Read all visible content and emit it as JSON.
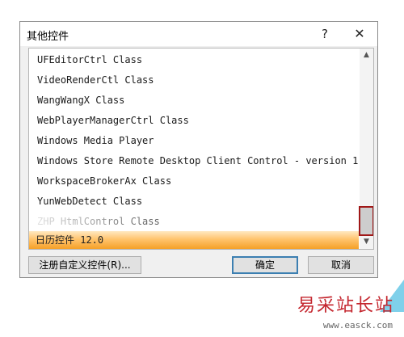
{
  "dialog": {
    "title": "其他控件",
    "help_glyph": "?",
    "close_glyph": "✕"
  },
  "list": {
    "items": [
      "UFEditorCtrl Class",
      "VideoRenderCtl Class",
      "WangWangX Class",
      "WebPlayerManagerCtrl Class",
      "Windows Media Player",
      "Windows Store Remote Desktop Client Control - version 1",
      "WorkspaceBrokerAx Class",
      "YunWebDetect Class",
      "ZHP HtmlControl Class",
      "日历控件 12.0"
    ],
    "selected_index": 9,
    "scroll_up_glyph": "▲",
    "scroll_down_glyph": "▼"
  },
  "buttons": {
    "register_label": "注册自定义控件(R)...",
    "ok_label": "确定",
    "cancel_label": "取消"
  },
  "watermark": {
    "brand": "易采站长站",
    "url": "www.easck.com"
  },
  "colors": {
    "selection_top": "#ffe9c2",
    "selection_bottom": "#f5a028",
    "highlight_box": "#a01818",
    "watermark": "#c4262e"
  }
}
